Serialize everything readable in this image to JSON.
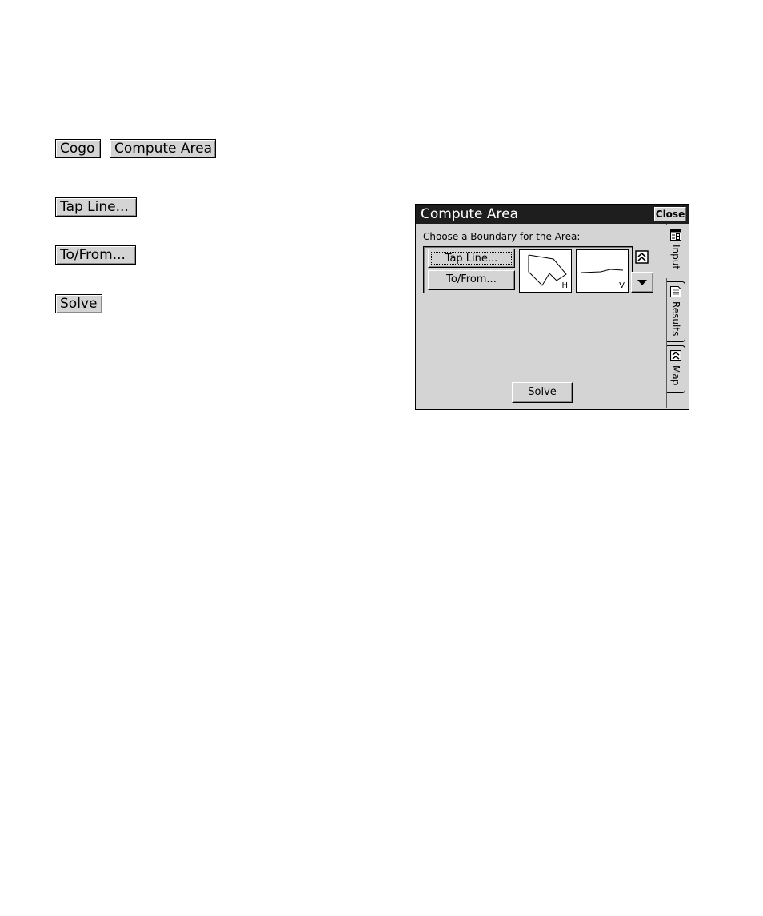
{
  "keys": {
    "cogo": "Cogo",
    "compute_area": "Compute Area",
    "tap_line": "Tap Line...",
    "to_from": "To/From...",
    "solve": "Solve"
  },
  "dialog": {
    "title": "Compute Area",
    "close_label": "Close",
    "prompt": "Choose a Boundary for the Area:",
    "tap_line_button": "Tap Line...",
    "to_from_button": "To/From...",
    "thumb_h_label": "H",
    "thumb_v_label": "V",
    "solve_prefix": "S",
    "solve_rest": "olve",
    "tabs": [
      {
        "label": "Input",
        "icon": "input-form-icon"
      },
      {
        "label": "Results",
        "icon": "results-sheet-icon"
      },
      {
        "label": "Map",
        "icon": "map-icon"
      }
    ]
  },
  "colors": {
    "titlebar": "#1e1e1e",
    "face": "#d4d4d4"
  }
}
